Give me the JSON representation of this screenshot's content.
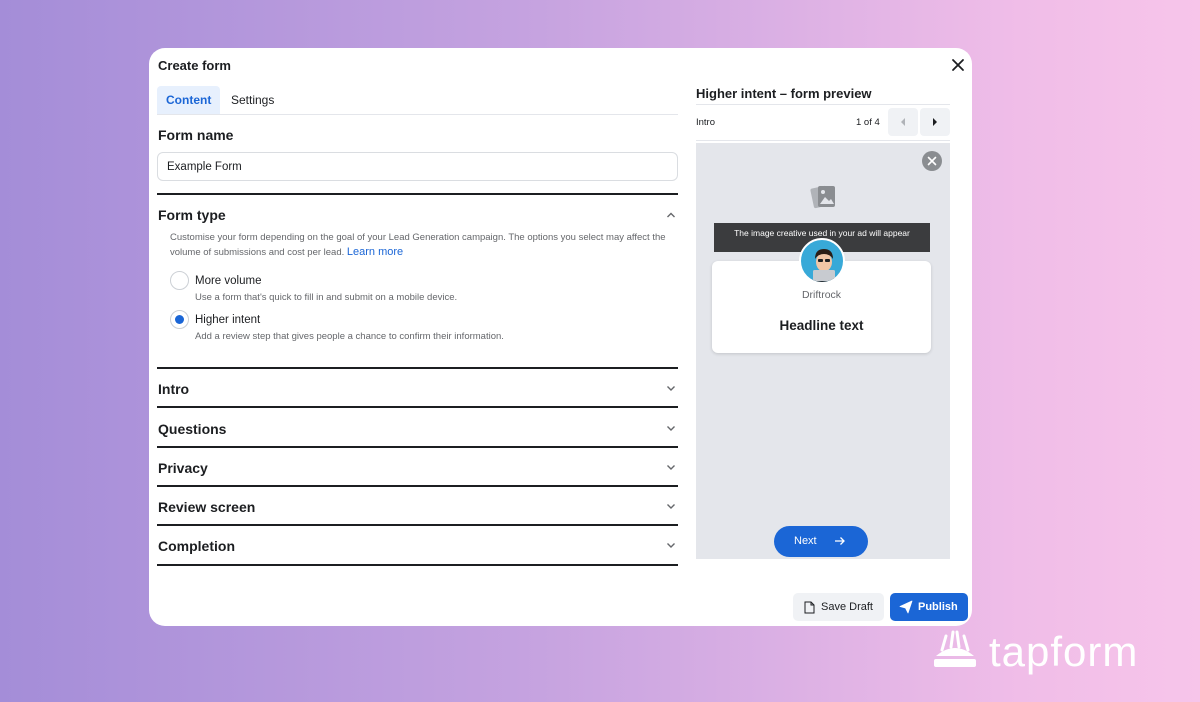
{
  "dialog": {
    "title": "Create form",
    "tabs": [
      {
        "label": "Content",
        "active": true
      },
      {
        "label": "Settings",
        "active": false
      }
    ],
    "form_name": {
      "heading": "Form name",
      "value": "Example Form"
    },
    "form_type": {
      "heading": "Form type",
      "description": "Customise your form depending on the goal of your Lead Generation campaign. The options you select may affect the volume of submissions and cost per lead.",
      "learn_more": "Learn more",
      "options": [
        {
          "label": "More volume",
          "sub": "Use a form that's quick to fill in and submit on a mobile device.",
          "selected": false
        },
        {
          "label": "Higher intent",
          "sub": "Add a review step that gives people a chance to confirm their information.",
          "selected": true
        }
      ]
    },
    "sections": [
      "Intro",
      "Questions",
      "Privacy",
      "Review screen",
      "Completion"
    ]
  },
  "preview": {
    "title": "Higher intent – form preview",
    "step_label": "Intro",
    "page_indicator": "1 of 4",
    "creative_note": "The image creative used in your ad will appear",
    "brand_name": "Driftrock",
    "headline": "Headline text",
    "next_label": "Next"
  },
  "footer": {
    "save_draft": "Save Draft",
    "publish": "Publish"
  },
  "watermark": {
    "text": "tapform"
  },
  "colors": {
    "accent": "#1b66d6",
    "active_tab_bg": "#e7f0fd",
    "preview_bg": "#e4e6eb"
  }
}
